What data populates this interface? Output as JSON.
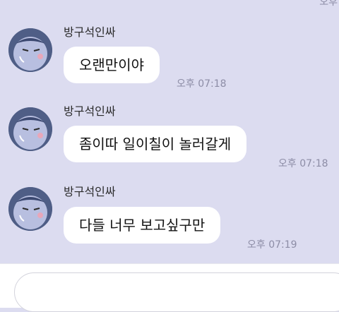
{
  "chat": {
    "top_time": "오후",
    "messages": [
      {
        "sender": "방구석인싸",
        "text": "오랜만이야",
        "time": "오후 07:18"
      },
      {
        "sender": "방구석인싸",
        "text": "좀이따 일이칠이 놀러갈게",
        "time": "오후 07:18"
      },
      {
        "sender": "방구석인싸",
        "text": "다들 너무 보고싶구만",
        "time": "오후 07:19"
      }
    ]
  },
  "composer": {
    "placeholder": ""
  },
  "colors": {
    "chat_bg": "#dcdcf0",
    "bubble": "#ffffff",
    "avatar": "#5b6a8f",
    "time_text": "#8d8da6"
  }
}
